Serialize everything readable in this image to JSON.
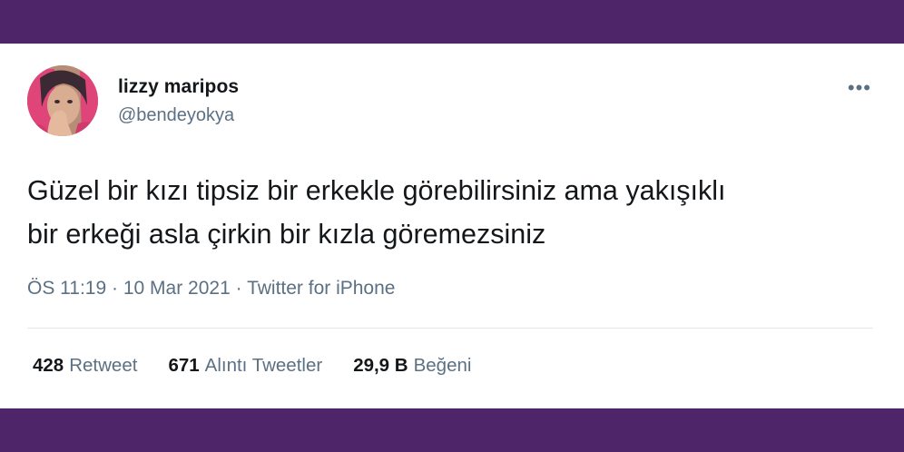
{
  "tweet": {
    "author_name": "lizzy maripos",
    "author_handle": "@bendeyokya",
    "more_label": "•••",
    "text_line1": "Güzel bir kızı tipsiz bir erkekle görebilirsiniz ama yakışıklı",
    "text_line2": "bir erkeği asla çirkin bir kızla göremezsiniz",
    "time": "ÖS 11:19",
    "separator": " · ",
    "date": "10 Mar 2021",
    "source": "Twitter for iPhone"
  },
  "stats": [
    {
      "count": "428",
      "label": "Retweet"
    },
    {
      "count": "671",
      "label": "Alıntı Tweetler"
    },
    {
      "count": "29,9 B",
      "label": "Beğeni"
    }
  ],
  "colors": {
    "frame": "#4e2569",
    "text": "#14171a",
    "secondary": "#5b7083",
    "divider": "#e1e8ed"
  },
  "icons": {
    "more": "more-horizontal-icon"
  }
}
